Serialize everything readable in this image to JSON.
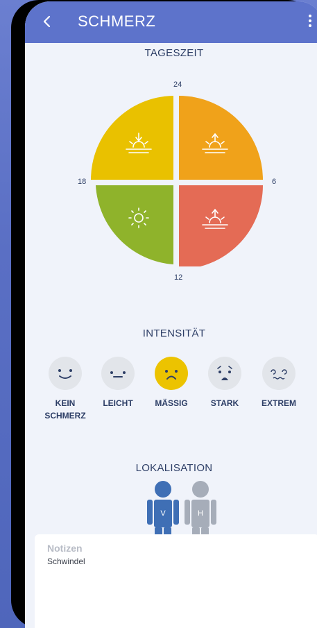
{
  "appbar": {
    "title": "SCHMERZ",
    "back_icon": "chevron-left-icon",
    "menu_icon": "more-vertical-icon",
    "color": "#5d73cb"
  },
  "tageszeit": {
    "title": "TAGESZEIT",
    "labels": {
      "top": "24",
      "right": "6",
      "bottom": "12",
      "left": "18"
    },
    "quadrants": [
      {
        "name": "night-to-morning",
        "color": "#f0a21a",
        "icon": "sunrise-icon"
      },
      {
        "name": "morning-to-noon",
        "color": "#e46b55",
        "icon": "sunrise-icon"
      },
      {
        "name": "noon-to-evening",
        "color": "#8fb32b",
        "icon": "sun-icon"
      },
      {
        "name": "evening-to-night",
        "color": "#e9c100",
        "icon": "sunset-icon"
      }
    ]
  },
  "intensitaet": {
    "title": "INTENSITÄT",
    "selected": "MÄSSIG",
    "items": [
      {
        "label_line1": "KEIN",
        "label_line2": "SCHMERZ",
        "icon": "smile-face-icon"
      },
      {
        "label_line1": "LEICHT",
        "label_line2": "",
        "icon": "neutral-face-icon"
      },
      {
        "label_line1": "MÄSSIG",
        "label_line2": "",
        "icon": "frown-face-icon"
      },
      {
        "label_line1": "STARK",
        "label_line2": "",
        "icon": "crying-face-icon"
      },
      {
        "label_line1": "EXTREM",
        "label_line2": "",
        "icon": "dizzy-face-icon"
      }
    ]
  },
  "lokalisation": {
    "title": "LOKALISATION",
    "front_label": "V",
    "back_label": "H",
    "front_color": "#3f6fb5",
    "back_color": "#a6adb9"
  },
  "notes": {
    "title": "Notizen",
    "text": "Schwindel"
  }
}
